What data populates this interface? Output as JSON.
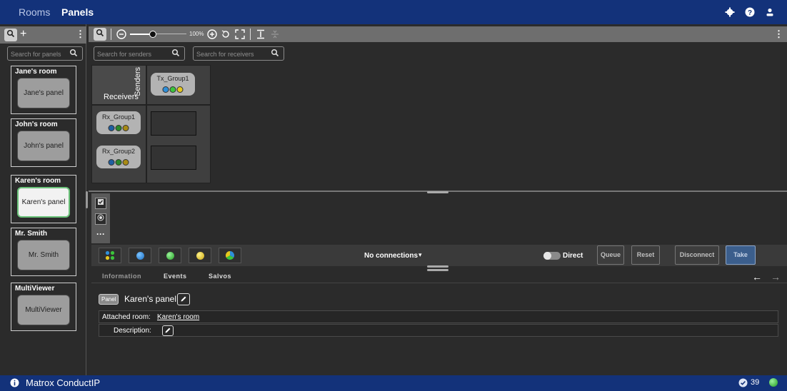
{
  "topbar": {
    "tabs": [
      "Rooms",
      "Panels"
    ],
    "icons": [
      "gear-icon",
      "help-icon",
      "user-icon"
    ]
  },
  "sidebar": {
    "search_placeholder": "Search for panels",
    "rooms": [
      {
        "room": "Jane's room",
        "panel": "Jane's panel"
      },
      {
        "room": "John's room",
        "panel": "John's panel"
      },
      {
        "room": "Karen's room",
        "panel": "Karen's panel"
      },
      {
        "room": "Mr. Smith",
        "panel": "Mr. Smith"
      },
      {
        "room": "MultiViewer",
        "panel": "MultiViewer"
      }
    ]
  },
  "toolbar": {
    "zoom_label": "100%",
    "senders_placeholder": "Search for senders",
    "receivers_placeholder": "Search for receivers"
  },
  "grid": {
    "senders_label": "Senders",
    "receivers_label": "Receivers",
    "tx_groups": [
      "Tx_Group1"
    ],
    "rx_groups": [
      "Rx_Group1",
      "Rx_Group2"
    ]
  },
  "connbar": {
    "connections_label": "No connections",
    "direct_label": "Direct",
    "queue": "Queue",
    "reset": "Reset",
    "disconnect": "Disconnect",
    "take": "Take"
  },
  "info": {
    "tabs": [
      "Information",
      "Events",
      "Salvos"
    ],
    "badge": "Panel",
    "panel_name": "Karen's panel",
    "attached_label": "Attached room:",
    "attached_value": "Karen's room",
    "description_label": "Description:"
  },
  "footer": {
    "brand": "Matrox ConductIP",
    "count": "39"
  },
  "colors": {
    "brand_bar": "#13327a",
    "selected_outline": "#6bc27a",
    "take_button": "#3b5e8c"
  }
}
